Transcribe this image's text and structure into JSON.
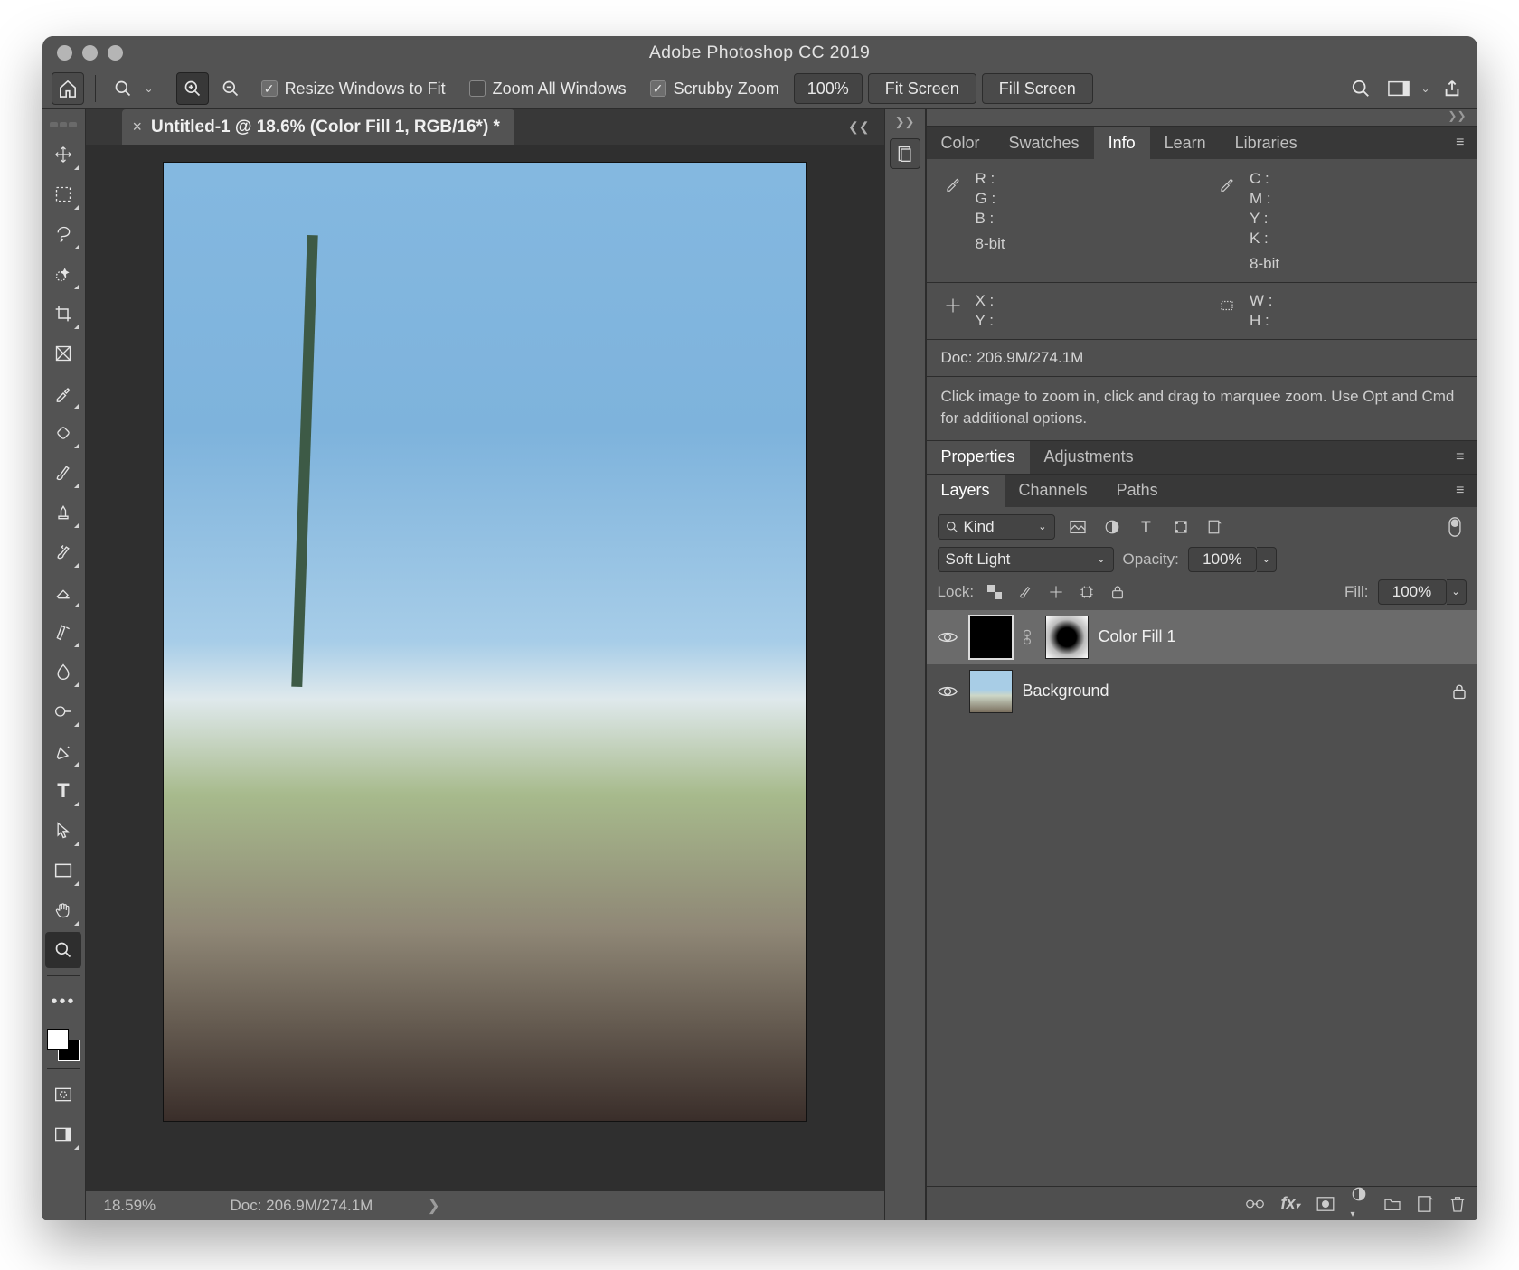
{
  "window": {
    "title": "Adobe Photoshop CC 2019"
  },
  "options_bar": {
    "resize_label": "Resize Windows to Fit",
    "zoom_all_label": "Zoom All Windows",
    "scrubby_label": "Scrubby Zoom",
    "zoom_value": "100%",
    "fit_screen": "Fit Screen",
    "fill_screen": "Fill Screen"
  },
  "document": {
    "tab_title": "Untitled-1 @ 18.6% (Color Fill 1, RGB/16*) *",
    "zoom_status": "18.59%",
    "doc_info_status": "Doc: 206.9M/274.1M"
  },
  "info_panel": {
    "tabs": [
      "Color",
      "Swatches",
      "Info",
      "Learn",
      "Libraries"
    ],
    "active_tab": "Info",
    "rgb": {
      "R": "R :",
      "G": "G :",
      "B": "B :",
      "bit": "8-bit"
    },
    "cmyk": {
      "C": "C :",
      "M": "M :",
      "Y": "Y :",
      "K": "K :",
      "bit": "8-bit"
    },
    "xy": {
      "X": "X :",
      "Y": "Y :"
    },
    "wh": {
      "W": "W :",
      "H": "H :"
    },
    "doc": "Doc: 206.9M/274.1M",
    "help": "Click image to zoom in, click and drag to marquee zoom.  Use Opt and Cmd for additional options."
  },
  "properties_panel": {
    "tabs": [
      "Properties",
      "Adjustments"
    ],
    "active_tab": "Properties"
  },
  "layers_panel": {
    "tabs": [
      "Layers",
      "Channels",
      "Paths"
    ],
    "active_tab": "Layers",
    "kind_label": "Kind",
    "blend_mode": "Soft Light",
    "opacity_label": "Opacity:",
    "opacity_value": "100%",
    "lock_label": "Lock:",
    "fill_label": "Fill:",
    "fill_value": "100%",
    "layers": [
      {
        "name": "Color Fill 1",
        "selected": true,
        "locked": false,
        "type": "fill"
      },
      {
        "name": "Background",
        "selected": false,
        "locked": true,
        "type": "image"
      }
    ]
  }
}
